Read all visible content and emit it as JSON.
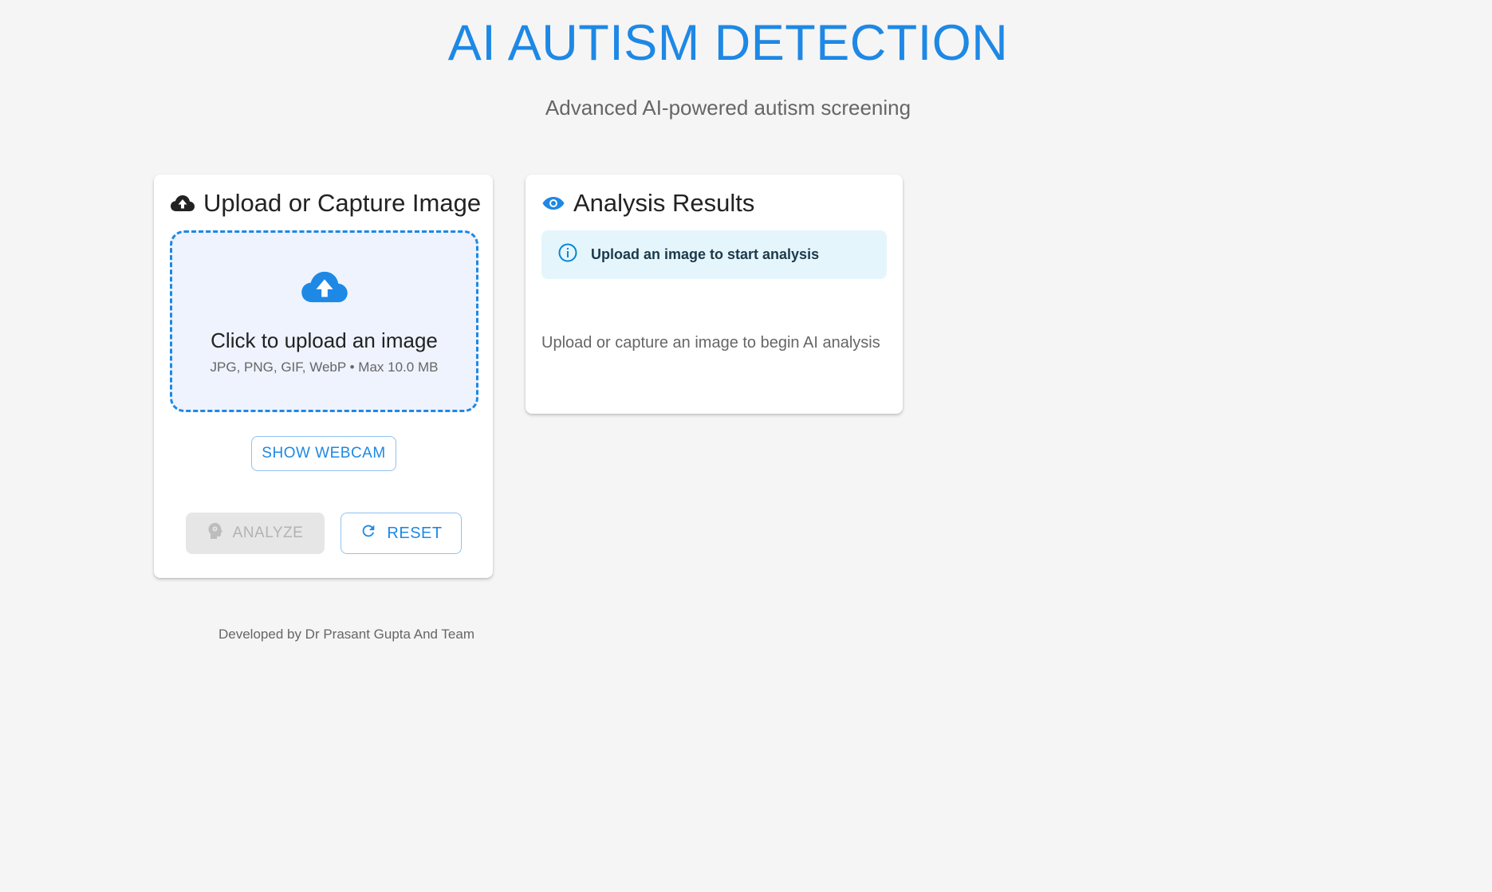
{
  "header": {
    "title": "AI AUTISM DETECTION",
    "subtitle": "Advanced AI-powered autism screening"
  },
  "upload_card": {
    "title": "Upload or Capture Image",
    "title_icon": "cloud-upload-icon",
    "dropzone": {
      "icon": "cloud-upload-icon",
      "main_text": "Click to upload an image",
      "sub_text": "JPG, PNG, GIF, WebP • Max 10.0 MB"
    },
    "webcam_button": "SHOW WEBCAM",
    "analyze_button": {
      "label": "ANALYZE",
      "icon": "psychology-icon",
      "disabled": true
    },
    "reset_button": {
      "label": "RESET",
      "icon": "refresh-icon"
    }
  },
  "results_card": {
    "title": "Analysis Results",
    "title_icon": "eye-icon",
    "alert": {
      "icon": "info-icon",
      "text": "Upload an image to start analysis"
    },
    "empty_text": "Upload or capture an image to begin AI analysis"
  },
  "footer": {
    "text": "Developed by Dr Prasant Gupta And Team"
  },
  "colors": {
    "accent": "#1e88e5",
    "background": "#f5f5f5",
    "alert_background": "#e5f5fc"
  }
}
